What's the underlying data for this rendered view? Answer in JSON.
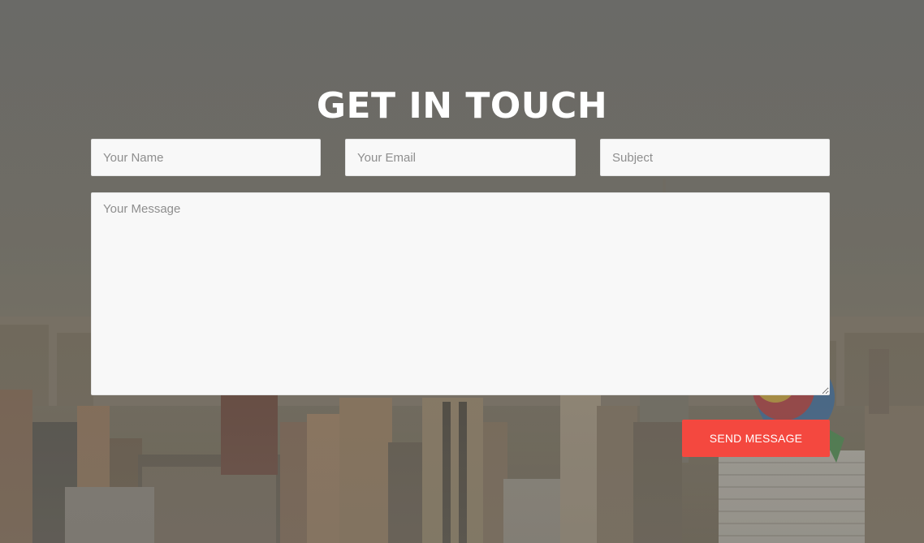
{
  "section": {
    "title": "GET IN TOUCH"
  },
  "form": {
    "name_placeholder": "Your Name",
    "email_placeholder": "Your Email",
    "subject_placeholder": "Subject",
    "message_placeholder": "Your Message",
    "submit_label": "SEND MESSAGE"
  },
  "colors": {
    "accent": "#f4483f",
    "field_background": "#f8f8f8",
    "title": "#ffffff"
  },
  "background": {
    "icon": "city-skyline-photo"
  }
}
